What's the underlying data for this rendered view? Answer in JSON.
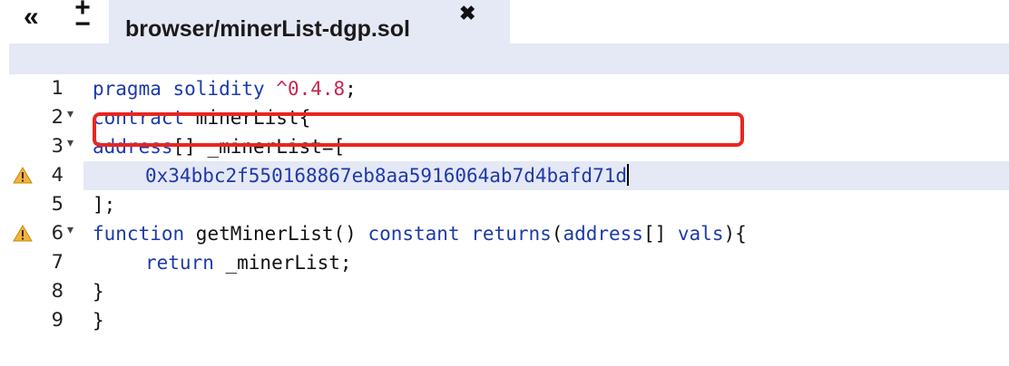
{
  "toolbar": {
    "collapse_label": "«",
    "zoom_in_label": "+",
    "zoom_out_label": "−"
  },
  "tab": {
    "title": "browser/minerList-dgp.sol",
    "close_label": "✖"
  },
  "editor": {
    "lines": [
      {
        "number": "1",
        "fold": "",
        "warning": false
      },
      {
        "number": "2",
        "fold": "▾",
        "warning": false
      },
      {
        "number": "3",
        "fold": "▾",
        "warning": false
      },
      {
        "number": "4",
        "fold": "",
        "warning": true
      },
      {
        "number": "5",
        "fold": "",
        "warning": false
      },
      {
        "number": "6",
        "fold": "▾",
        "warning": true
      },
      {
        "number": "7",
        "fold": "",
        "warning": false
      },
      {
        "number": "8",
        "fold": "",
        "warning": false
      },
      {
        "number": "9",
        "fold": "",
        "warning": false
      }
    ],
    "code": {
      "l1_kw": "pragma solidity ",
      "l1_ver": "^0.4.8",
      "l1_end": ";",
      "l2_kw": "contract",
      "l2_rest": " minerList{",
      "l3_kw": "address",
      "l3_rest": "[] _minerList=[",
      "l4_addr": "0x34bbc2f550168867eb8aa5916064ab7d4bafd71d",
      "l5": "];",
      "l6_fn": "function",
      "l6_name": " getMinerList() ",
      "l6_const": "constant",
      "l6_sp": " ",
      "l6_ret": "returns",
      "l6_paren": "(",
      "l6_addr": "address",
      "l6_br": "[] ",
      "l6_vals": "vals",
      "l6_end": "){",
      "l7_ret": "return",
      "l7_rest": " _minerList;",
      "l8": "}",
      "l9": "}"
    },
    "colors": {
      "keyword": "#1d3aa8",
      "literal": "#c7254e",
      "highlight": "#e5e8f5",
      "annotation": "#e8261f"
    },
    "icons": {
      "warning": "warning-triangle-icon",
      "fold": "fold-arrow-icon"
    }
  }
}
